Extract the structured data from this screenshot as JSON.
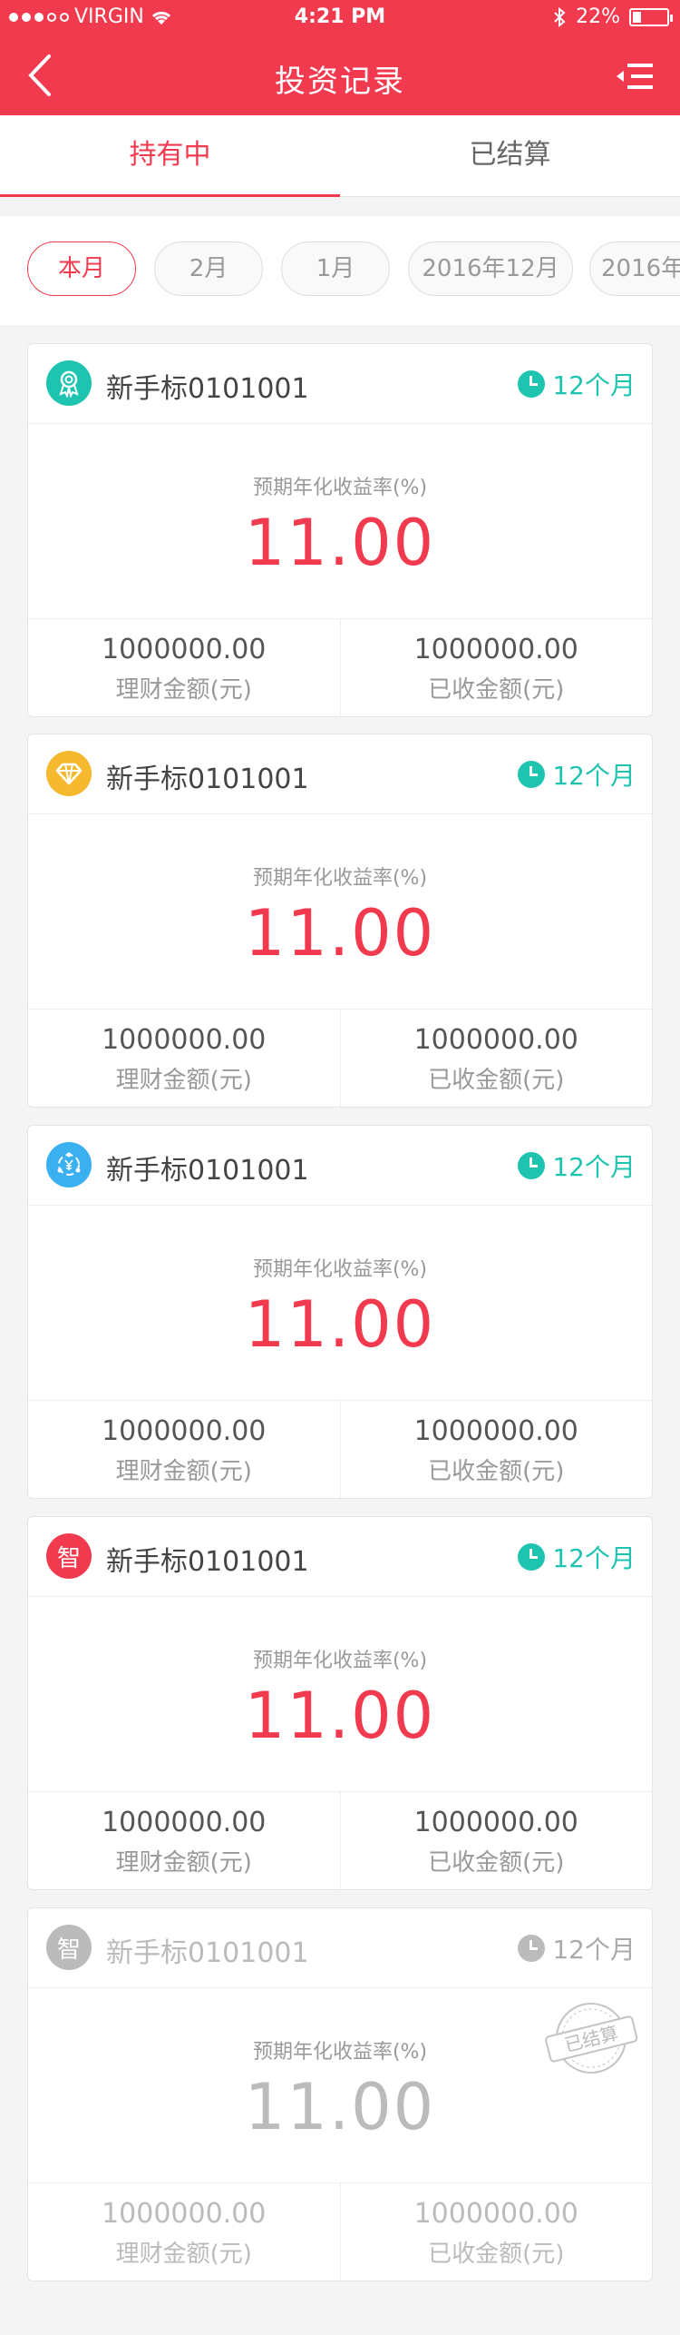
{
  "status_bar": {
    "carrier": "VIRGIN",
    "time": "4:21 PM",
    "battery": "22%"
  },
  "nav": {
    "title": "投资记录"
  },
  "tabs": [
    {
      "label": "持有中",
      "active": true
    },
    {
      "label": "已结算",
      "active": false
    }
  ],
  "months": [
    {
      "label": "本月",
      "active": true
    },
    {
      "label": "2月",
      "active": false
    },
    {
      "label": "1月",
      "active": false
    },
    {
      "label": "2016年12月",
      "active": false
    },
    {
      "label": "2016年",
      "active": false
    }
  ],
  "cards": [
    {
      "name": "新手标0101001",
      "term": "12个月",
      "rate_label": "预期年化收益率(%)",
      "rate": "11.00",
      "amount_invested": "1000000.00",
      "invested_label": "理财金额(元)",
      "amount_received": "1000000.00",
      "received_label": "已收金额(元)",
      "icon": "medal-icon",
      "icon_color": "#1fc4b0"
    },
    {
      "name": "新手标0101001",
      "term": "12个月",
      "rate_label": "预期年化收益率(%)",
      "rate": "11.00",
      "amount_invested": "1000000.00",
      "invested_label": "理财金额(元)",
      "amount_received": "1000000.00",
      "received_label": "已收金额(元)",
      "icon": "diamond-icon",
      "icon_color": "#f5b82e"
    },
    {
      "name": "新手标0101001",
      "term": "12个月",
      "rate_label": "预期年化收益率(%)",
      "rate": "11.00",
      "amount_invested": "1000000.00",
      "invested_label": "理财金额(元)",
      "amount_received": "1000000.00",
      "received_label": "已收金额(元)",
      "icon": "yen-cycle-icon",
      "icon_color": "#3ab0f0"
    },
    {
      "name": "新手标0101001",
      "term": "12个月",
      "rate_label": "预期年化收益率(%)",
      "rate": "11.00",
      "amount_invested": "1000000.00",
      "invested_label": "理财金额(元)",
      "amount_received": "1000000.00",
      "received_label": "已收金额(元)",
      "icon": "zhi-badge-icon",
      "icon_color": "#f23a4f",
      "icon_text": "智"
    },
    {
      "name": "新手标0101001",
      "term": "12个月",
      "rate_label": "预期年化收益率(%)",
      "rate": "11.00",
      "amount_invested": "1000000.00",
      "invested_label": "理财金额(元)",
      "amount_received": "1000000.00",
      "received_label": "已收金额(元)",
      "icon": "zhi-badge-icon",
      "icon_color": "#bbbbbb",
      "icon_text": "智",
      "settled": true,
      "stamp_text": "已结算"
    }
  ],
  "colors": {
    "brand": "#f23a4f",
    "accent_teal": "#1fc4b0",
    "muted": "#bbbbbb"
  }
}
